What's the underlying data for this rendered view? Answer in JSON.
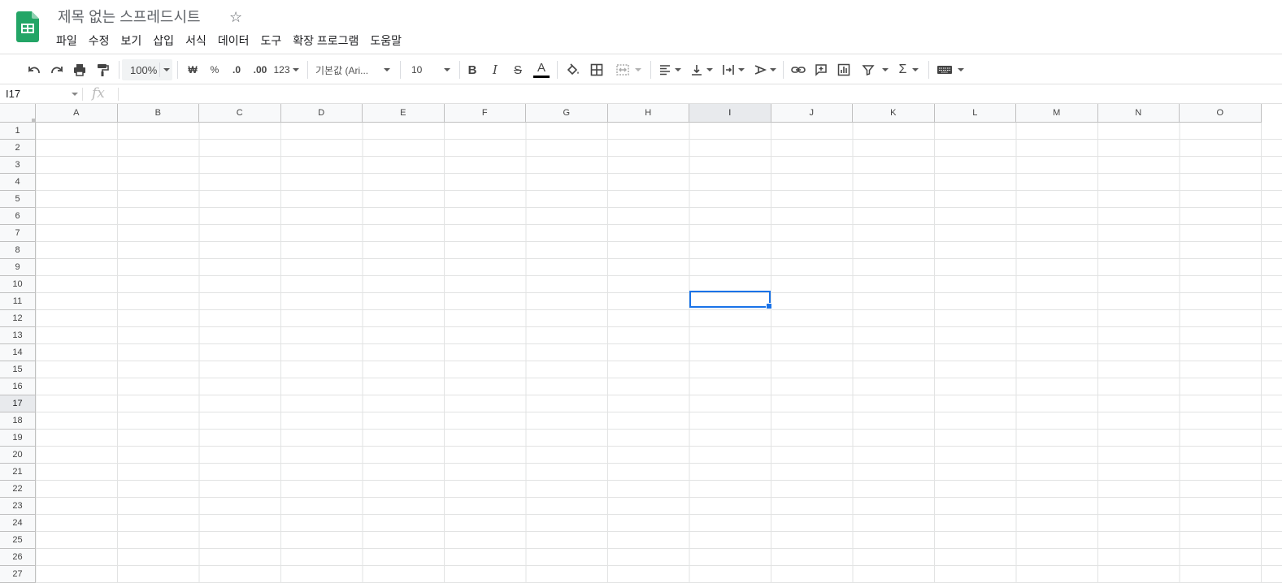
{
  "header": {
    "title": "제목 없는 스프레드시트",
    "menu": [
      "파일",
      "수정",
      "보기",
      "삽입",
      "서식",
      "데이터",
      "도구",
      "확장 프로그램",
      "도움말"
    ]
  },
  "toolbar": {
    "zoom": "100%",
    "currency": "₩",
    "percent": "%",
    "dec_decrease": ".0",
    "dec_increase": ".00",
    "format_more": "123",
    "font": "기본값 (Ari...",
    "font_size": "10",
    "bold": "B",
    "italic": "I",
    "strike": "S",
    "text_color_letter": "A",
    "sum": "Σ"
  },
  "formula_bar": {
    "name_box": "I17",
    "fx": "fx",
    "value": ""
  },
  "grid": {
    "columns": [
      "A",
      "B",
      "C",
      "D",
      "E",
      "F",
      "G",
      "H",
      "I",
      "J",
      "K",
      "L",
      "M",
      "N",
      "O"
    ],
    "rows": [
      "1",
      "2",
      "3",
      "4",
      "5",
      "6",
      "7",
      "8",
      "9",
      "10",
      "11",
      "12",
      "13",
      "14",
      "15",
      "16",
      "17",
      "18",
      "19",
      "20",
      "21",
      "22",
      "23",
      "24",
      "25",
      "26",
      "27"
    ],
    "selected_column": "I",
    "selected_row": "17"
  },
  "colors": {
    "accent": "#1a73e8",
    "sheets_green": "#0f9d58",
    "header_bg": "#f8f9fa"
  }
}
